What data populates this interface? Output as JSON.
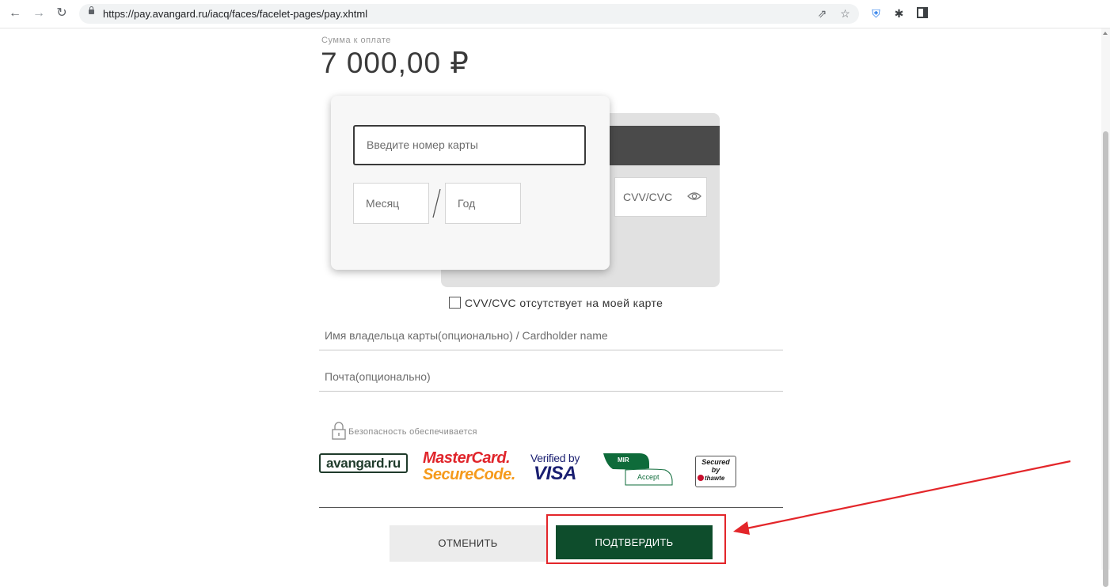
{
  "browser": {
    "url": "https://pay.avangard.ru/iacq/faces/facelet-pages/pay.xhtml",
    "icons": [
      "back-icon",
      "forward-icon",
      "reload-icon",
      "lock-icon",
      "share-icon",
      "star-icon",
      "shield-extension-icon",
      "puzzle-extension-icon",
      "sidepanel-icon"
    ]
  },
  "payment": {
    "amount_label": "Сумма к оплате",
    "amount": "7 000,00 ₽"
  },
  "card": {
    "number_placeholder": "Введите номер карты",
    "month_placeholder": "Месяц",
    "year_placeholder": "Год",
    "cvv_placeholder": "CVV/CVC",
    "cvv_absent_label": "CVV/CVC отсутствует на моей карте",
    "cvv_absent_checked": false
  },
  "fields": {
    "cardholder_placeholder": "Имя владельца карты(опционально) / Cardholder name",
    "email_placeholder": "Почта(опционально)"
  },
  "security": {
    "text": "Безопасность обеспечивается",
    "logos": {
      "avangard": "avangard.ru",
      "mastercard_line1": "MasterCard.",
      "mastercard_line2": "SecureCode.",
      "visa_line1": "Verified by",
      "visa_line2": "VISA",
      "mir_line1": "MIR",
      "mir_line2": "Accept",
      "thawte_line1": "Secured",
      "thawte_line2": "by",
      "thawte_line3": "thawte"
    }
  },
  "buttons": {
    "cancel": "ОТМЕНИТЬ",
    "confirm": "ПОДТВЕРДИТЬ"
  },
  "colors": {
    "confirm_bg": "#0e4d2c",
    "cancel_bg": "#ececec",
    "annotation_red": "#e3262a",
    "card_stripe": "#4a4a4a"
  }
}
